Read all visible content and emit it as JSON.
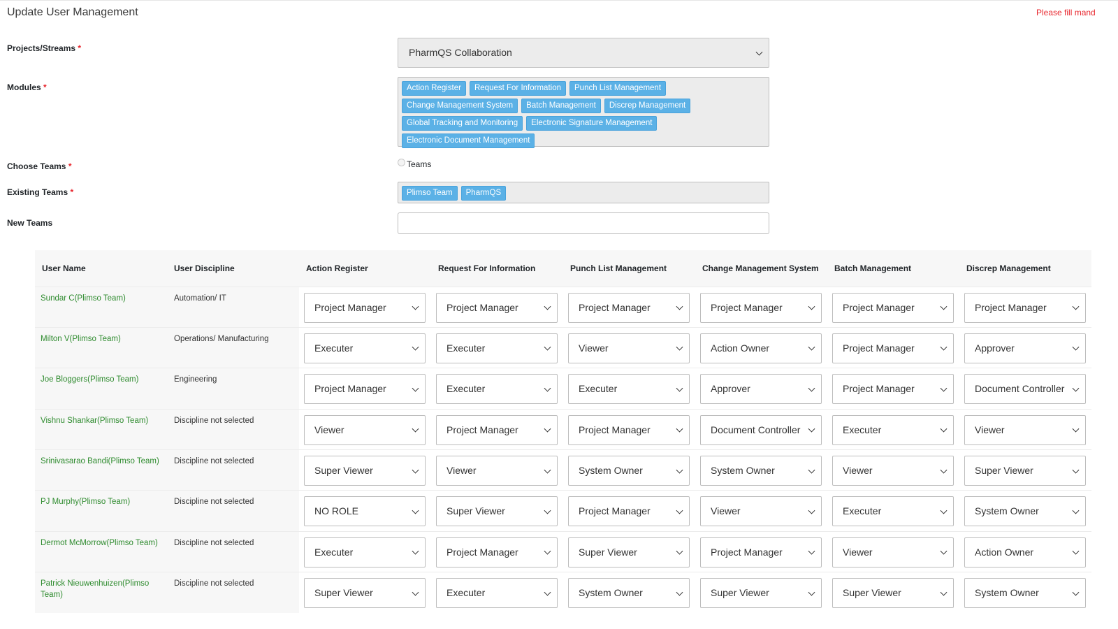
{
  "page": {
    "title": "Update User Management",
    "warning": "Please fill mand"
  },
  "form": {
    "projects_label": "Projects/Streams",
    "projects_value": "PharmQS Collaboration",
    "modules_label": "Modules",
    "modules": [
      "Action Register",
      "Request For Information",
      "Punch List Management",
      "Change Management System",
      "Batch Management",
      "Discrep Management",
      "Global Tracking and Monitoring",
      "Electronic Signature Management",
      "Electronic Document Management"
    ],
    "choose_teams_label": "Choose Teams",
    "teams_radio_label": "Teams",
    "existing_teams_label": "Existing Teams",
    "existing_teams": [
      "Plimso Team",
      "PharmQS"
    ],
    "new_teams_label": "New Teams",
    "new_teams_value": "",
    "required_mark": "*"
  },
  "table": {
    "headers": [
      "User Name",
      "User Discipline",
      "Action Register",
      "Request For Information",
      "Punch List Management",
      "Change Management System",
      "Batch Management",
      "Discrep Management"
    ],
    "rows": [
      {
        "name": "Sundar C(Plimso Team)",
        "discipline": "Automation/ IT",
        "roles": [
          "Project Manager",
          "Project Manager",
          "Project Manager",
          "Project Manager",
          "Project Manager",
          "Project Manager"
        ]
      },
      {
        "name": "Milton V(Plimso Team)",
        "discipline": "Operations/ Manufacturing",
        "roles": [
          "Executer",
          "Executer",
          "Viewer",
          "Action Owner",
          "Project Manager",
          "Approver"
        ]
      },
      {
        "name": "Joe Bloggers(Plimso Team)",
        "discipline": "Engineering",
        "roles": [
          "Project Manager",
          "Executer",
          "Executer",
          "Approver",
          "Project Manager",
          "Document Controller"
        ]
      },
      {
        "name": "Vishnu Shankar(Plimso Team)",
        "discipline": "Discipline not selected",
        "roles": [
          "Viewer",
          "Project Manager",
          "Project Manager",
          "Document Controller",
          "Executer",
          "Viewer"
        ]
      },
      {
        "name": "Srinivasarao Bandi(Plimso Team)",
        "discipline": "Discipline not selected",
        "roles": [
          "Super Viewer",
          "Viewer",
          "System Owner",
          "System Owner",
          "Viewer",
          "Super Viewer"
        ]
      },
      {
        "name": "PJ Murphy(Plimso Team)",
        "discipline": "Discipline not selected",
        "roles": [
          "NO ROLE",
          "Super Viewer",
          "Project Manager",
          "Viewer",
          "Executer",
          "System Owner"
        ]
      },
      {
        "name": "Dermot McMorrow(Plimso Team)",
        "discipline": "Discipline not selected",
        "roles": [
          "Executer",
          "Project Manager",
          "Super Viewer",
          "Project Manager",
          "Viewer",
          "Action Owner"
        ]
      },
      {
        "name": "Patrick Nieuwenhuizen(Plimso Team)",
        "discipline": "Discipline not selected",
        "roles": [
          "Super Viewer",
          "Executer",
          "System Owner",
          "Super Viewer",
          "Super Viewer",
          "System Owner"
        ]
      }
    ]
  },
  "colors": {
    "tag_bg": "#5bb1e6",
    "user_name": "#2e8b2e",
    "required": "#e8262d"
  }
}
